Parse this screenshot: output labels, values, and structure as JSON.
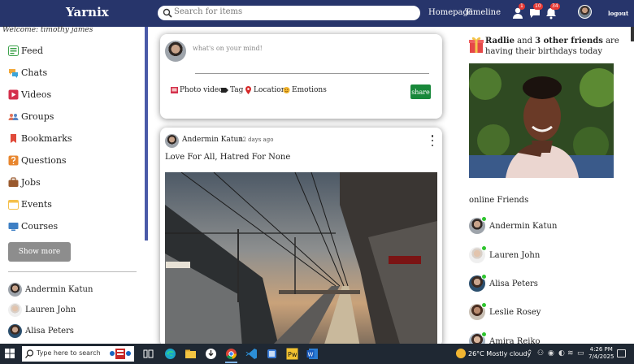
{
  "header": {
    "logo": "Yarnix",
    "search_placeholder": "Search for items",
    "links": [
      "Homepage",
      "Timeline"
    ],
    "notifications": {
      "friends": "1",
      "messages": "10",
      "alerts": "34"
    },
    "logout": "logout"
  },
  "sidebar": {
    "welcome": "Welcome: timothy james",
    "items": [
      {
        "label": "Feed",
        "icon": "feed-icon",
        "color": "#3fa34d"
      },
      {
        "label": "Chats",
        "icon": "chats-icon",
        "color": "#f2a93b"
      },
      {
        "label": "Videos",
        "icon": "videos-icon",
        "color": "#d4304c"
      },
      {
        "label": "Groups",
        "icon": "groups-icon",
        "color": "#e0735a"
      },
      {
        "label": "Bookmarks",
        "icon": "bookmarks-icon",
        "color": "#e04a3a"
      },
      {
        "label": "Questions",
        "icon": "questions-icon",
        "color": "#e8862e"
      },
      {
        "label": "Jobs",
        "icon": "jobs-icon",
        "color": "#9a5a2e"
      },
      {
        "label": "Events",
        "icon": "events-icon",
        "color": "#f5c04a"
      },
      {
        "label": "Courses",
        "icon": "courses-icon",
        "color": "#3d7fc4"
      }
    ],
    "show_more": "Show more",
    "friends": [
      "Andermin Katun",
      "Lauren John",
      "Alisa Peters"
    ]
  },
  "share": {
    "placeholder": "what's on your mind!",
    "options": [
      "Photo video",
      "Tag",
      "Location",
      "Emotions"
    ],
    "button": "share"
  },
  "post": {
    "author": "Andermin Katun",
    "time": "12 days ago",
    "text": "Love For All, Hatred For None"
  },
  "birthday": {
    "name": "Radlie",
    "middle": " and ",
    "others": "3 other friends",
    "rest": " are having their birthdays today"
  },
  "online": {
    "title": "online Friends",
    "friends": [
      "Andermin Katun",
      "Lauren John",
      "Alisa Peters",
      "Leslie Rosey",
      "Amira Reiko"
    ]
  },
  "taskbar": {
    "search_placeholder": "Type here to search",
    "weather": "26°C  Mostly cloudy",
    "time": "4:26 PM",
    "date": "7/4/2025"
  },
  "colors": {
    "header": "#27356b",
    "accent_bar": "#4a5aa8",
    "share_button": "#18883a",
    "online_dot": "#2ec52e",
    "taskbar": "#1f2833"
  }
}
